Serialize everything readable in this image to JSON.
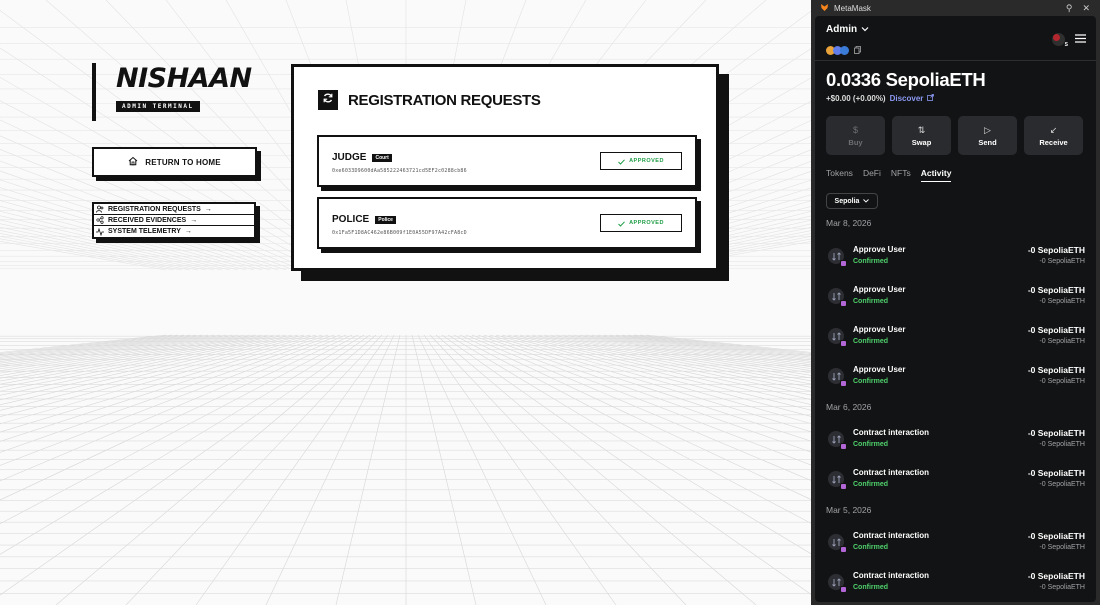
{
  "app": {
    "brand": "NISHAAN",
    "tag": "ADMIN TERMINAL",
    "home_button": "RETURN TO HOME",
    "nav": [
      {
        "label": "REGISTRATION REQUESTS",
        "icon": "users-icon"
      },
      {
        "label": "RECEIVED EVIDENCES",
        "icon": "share-icon"
      },
      {
        "label": "SYSTEM TELEMETRY",
        "icon": "pulse-icon"
      }
    ],
    "nav_arrow": "→",
    "panel_title": "REGISTRATION REQUESTS",
    "requests": [
      {
        "name": "JUDGE",
        "badge": "Court",
        "address": "0xe6033D9600dAa585222463721cd5EF2c0288cb86",
        "status": "APPROVED"
      },
      {
        "name": "POLICE",
        "badge": "Police",
        "address": "0x1Fa5F1D8AC462e86B009f1E0A55DF97A42cFA8cD",
        "status": "APPROVED"
      }
    ]
  },
  "metamask": {
    "window_title": "MetaMask",
    "account": "Admin",
    "avatar_letter": "S",
    "balance": "0.0336 SepoliaETH",
    "change": "+$0.00 (+0.00%)",
    "discover": "Discover",
    "actions": [
      {
        "label": "Buy",
        "icon": "$",
        "disabled": true
      },
      {
        "label": "Swap",
        "icon": "⇅",
        "disabled": false
      },
      {
        "label": "Send",
        "icon": "▷",
        "disabled": false
      },
      {
        "label": "Receive",
        "icon": "↙",
        "disabled": false
      }
    ],
    "tabs": [
      "Tokens",
      "DeFi",
      "NFTs",
      "Activity"
    ],
    "active_tab": "Activity",
    "network_filter": "Sepolia",
    "groups": [
      {
        "date": "Mar 8, 2026",
        "items": [
          {
            "title": "Approve User",
            "status": "Confirmed",
            "amount": "-0 SepoliaETH",
            "amount2": "-0 SepoliaETH"
          },
          {
            "title": "Approve User",
            "status": "Confirmed",
            "amount": "-0 SepoliaETH",
            "amount2": "-0 SepoliaETH"
          },
          {
            "title": "Approve User",
            "status": "Confirmed",
            "amount": "-0 SepoliaETH",
            "amount2": "-0 SepoliaETH"
          },
          {
            "title": "Approve User",
            "status": "Confirmed",
            "amount": "-0 SepoliaETH",
            "amount2": "-0 SepoliaETH"
          }
        ]
      },
      {
        "date": "Mar 6, 2026",
        "items": [
          {
            "title": "Contract interaction",
            "status": "Confirmed",
            "amount": "-0 SepoliaETH",
            "amount2": "-0 SepoliaETH"
          },
          {
            "title": "Contract interaction",
            "status": "Confirmed",
            "amount": "-0 SepoliaETH",
            "amount2": "-0 SepoliaETH"
          }
        ]
      },
      {
        "date": "Mar 5, 2026",
        "items": [
          {
            "title": "Contract interaction",
            "status": "Confirmed",
            "amount": "-0 SepoliaETH",
            "amount2": "-0 SepoliaETH"
          },
          {
            "title": "Contract interaction",
            "status": "Confirmed",
            "amount": "-0 SepoliaETH",
            "amount2": "-0 SepoliaETH"
          }
        ]
      }
    ],
    "colors": {
      "confirmed": "#4fd06c",
      "discover": "#8b99f3",
      "approved": "#1f9d45"
    }
  }
}
